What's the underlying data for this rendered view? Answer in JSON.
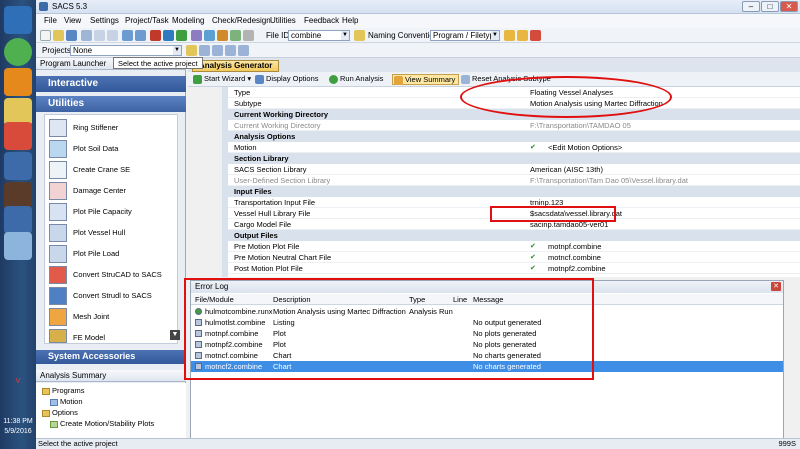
{
  "window": {
    "title": "SACS 5.3"
  },
  "taskbar": {
    "time": "11:38 PM",
    "date": "5/9/2016",
    "tray_label": "V"
  },
  "menu": [
    "File",
    "View",
    "Settings",
    "Project/Task",
    "Modeling",
    "Check/Redesign",
    "Utilities",
    "Feedback",
    "Help"
  ],
  "toolbar": {
    "file_id_label": "File ID",
    "file_id_value": "combine",
    "naming_label": "Naming Convention",
    "naming_value": "Program / Filetype.ID",
    "projects_label": "Projects",
    "projects_value": "None"
  },
  "tooltip": "Select the active project",
  "left": {
    "launcher_title": "Program Launcher",
    "interactive": "Interactive",
    "utilities": "Utilities",
    "items": [
      {
        "label": "Ring Stiffener",
        "icon": "ring-stiffener-icon"
      },
      {
        "label": "Plot Soil Data",
        "icon": "soil-data-icon"
      },
      {
        "label": "Create Crane SE",
        "icon": "crane-icon"
      },
      {
        "label": "Damage Center",
        "icon": "damage-center-icon"
      },
      {
        "label": "Plot Pile Capacity",
        "icon": "pile-capacity-icon"
      },
      {
        "label": "Plot Vessel Hull",
        "icon": "vessel-hull-icon"
      },
      {
        "label": "Plot Pile Load",
        "icon": "pile-load-icon"
      },
      {
        "label": "Convert StruCAD to SACS",
        "icon": "strucad-icon"
      },
      {
        "label": "Convert Strudl to SACS",
        "icon": "strudl-icon"
      },
      {
        "label": "Mesh Joint",
        "icon": "mesh-joint-icon"
      },
      {
        "label": "FE Model",
        "icon": "fe-model-icon"
      }
    ],
    "system_accessories": "System Accessories",
    "analysis_summary": "Analysis Summary",
    "tree": {
      "programs": "Programs",
      "motion": "Motion",
      "options": "Options",
      "create_plots": "Create Motion/Stability Plots"
    }
  },
  "tabs": {
    "active": "Analysis Generator"
  },
  "gen_toolbar": {
    "start_wizard": "Start Wizard",
    "display_options": "Display Options",
    "run_analysis": "Run Analysis",
    "view_summary": "View Summary",
    "reset": "Reset Analysis Subtype"
  },
  "grid": [
    {
      "kind": "row",
      "key": "Type",
      "value": "Floating Vessel Analyses"
    },
    {
      "kind": "row",
      "key": "Subtype",
      "value": "Motion Analysis using Martec Diffraction"
    },
    {
      "kind": "cat",
      "key": "Current Working Directory"
    },
    {
      "kind": "dim",
      "key": "Current Working Directory",
      "value": "F:\\Transportation\\TAMDAO 05"
    },
    {
      "kind": "cat",
      "key": "Analysis Options"
    },
    {
      "kind": "check",
      "key": "Motion",
      "value": "<Edit Motion Options>"
    },
    {
      "kind": "cat",
      "key": "Section Library"
    },
    {
      "kind": "row",
      "key": "SACS Section Library",
      "value": "American (AISC 13th)"
    },
    {
      "kind": "dim",
      "key": "User-Defined Section Library",
      "value": "F:\\Transportation\\Tam Dao 05\\Vessel.library.dat"
    },
    {
      "kind": "cat",
      "key": "Input Files"
    },
    {
      "kind": "row",
      "key": "Transportation Input File",
      "value": "trninp.123"
    },
    {
      "kind": "row",
      "key": "Vessel Hull Library File",
      "value": "$sacsdata\\vessel.library.dat"
    },
    {
      "kind": "row",
      "key": "Cargo Model File",
      "value": "sacinp.tamdao05-ver01"
    },
    {
      "kind": "cat",
      "key": "Output Files"
    },
    {
      "kind": "check",
      "key": "Pre Motion Plot File",
      "value": "motnpf.combine"
    },
    {
      "kind": "check",
      "key": "Pre Motion Neutral Chart File",
      "value": "motncf.combine"
    },
    {
      "kind": "check",
      "key": "Post Motion Plot File",
      "value": "motnpf2.combine"
    }
  ],
  "errlog": {
    "title": "Error Log",
    "columns": [
      "File/Module",
      "Description",
      "Type",
      "Line",
      "Message"
    ],
    "rows": [
      [
        "hulmotcombine.runx",
        "Motion Analysis using Martec Diffraction",
        "Analysis Run",
        "",
        ""
      ],
      [
        "hulmotlst.combine",
        "Listing",
        "",
        "",
        "No output generated"
      ],
      [
        "motnpf.combine",
        "Plot",
        "",
        "",
        "No plots generated"
      ],
      [
        "motnpf2.combine",
        "Plot",
        "",
        "",
        "No plots generated"
      ],
      [
        "motncf.combine",
        "Chart",
        "",
        "",
        "No charts generated"
      ],
      [
        "motncf2.combine",
        "Chart",
        "",
        "",
        "No charts generated"
      ]
    ],
    "selected_index": 5
  },
  "status": {
    "left": "Select the active project",
    "right": "999S"
  },
  "colors": {
    "annotation": "#e01010",
    "section_header": "#34599a",
    "selection": "#3f8ee6"
  }
}
